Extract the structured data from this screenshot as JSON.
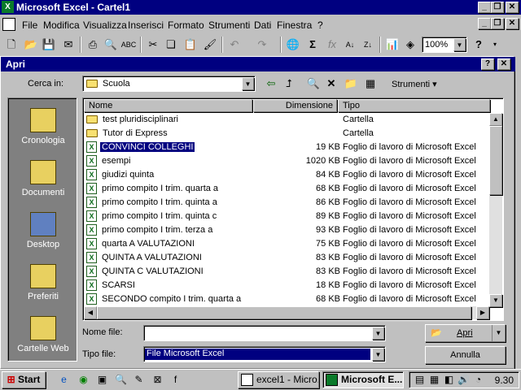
{
  "app": {
    "title": "Microsoft Excel - Cartel1",
    "menu": [
      "File",
      "Modifica",
      "Visualizza",
      "Inserisci",
      "Formato",
      "Strumenti",
      "Dati",
      "Finestra",
      "?"
    ],
    "zoom": "100%",
    "help_glyph": "?"
  },
  "dialog": {
    "title": "Apri",
    "look_in_label": "Cerca in:",
    "look_in_value": "Scuola",
    "tools_label": "Strumenti",
    "places": [
      "Cronologia",
      "Documenti",
      "Desktop",
      "Preferiti",
      "Cartelle Web"
    ],
    "columns": {
      "name": "Nome",
      "size": "Dimensione",
      "type": "Tipo"
    },
    "files": [
      {
        "name": "test pluridisciplinari",
        "size": "",
        "type": "Cartella",
        "kind": "folder"
      },
      {
        "name": "Tutor di Express",
        "size": "",
        "type": "Cartella",
        "kind": "folder"
      },
      {
        "name": "CONVINCI COLLEGHI",
        "size": "19 KB",
        "type": "Foglio di lavoro di Microsoft Excel",
        "kind": "xls",
        "selected": true
      },
      {
        "name": "esempi",
        "size": "1020 KB",
        "type": "Foglio di lavoro di Microsoft Excel",
        "kind": "xls"
      },
      {
        "name": "giudizi quinta",
        "size": "84 KB",
        "type": "Foglio di lavoro di Microsoft Excel",
        "kind": "xls"
      },
      {
        "name": "primo compito I trim. quarta a",
        "size": "68 KB",
        "type": "Foglio di lavoro di Microsoft Excel",
        "kind": "xls"
      },
      {
        "name": "primo compito I trim. quinta a",
        "size": "86 KB",
        "type": "Foglio di lavoro di Microsoft Excel",
        "kind": "xls"
      },
      {
        "name": "primo compito I trim. quinta c",
        "size": "89 KB",
        "type": "Foglio di lavoro di Microsoft Excel",
        "kind": "xls"
      },
      {
        "name": "primo compito I trim. terza a",
        "size": "93 KB",
        "type": "Foglio di lavoro di Microsoft Excel",
        "kind": "xls"
      },
      {
        "name": "quarta A VALUTAZIONI",
        "size": "75 KB",
        "type": "Foglio di lavoro di Microsoft Excel",
        "kind": "xls"
      },
      {
        "name": "QUINTA A VALUTAZIONI",
        "size": "83 KB",
        "type": "Foglio di lavoro di Microsoft Excel",
        "kind": "xls"
      },
      {
        "name": "QUINTA C VALUTAZIONI",
        "size": "83 KB",
        "type": "Foglio di lavoro di Microsoft Excel",
        "kind": "xls"
      },
      {
        "name": "SCARSI",
        "size": "18 KB",
        "type": "Foglio di lavoro di Microsoft Excel",
        "kind": "xls"
      },
      {
        "name": "SECONDO compito I trim. quarta a",
        "size": "68 KB",
        "type": "Foglio di lavoro di Microsoft Excel",
        "kind": "xls"
      }
    ],
    "filename_label": "Nome file:",
    "filename_value": "",
    "filetype_label": "Tipo file:",
    "filetype_value": "File Microsoft Excel",
    "open_button": "Apri",
    "cancel_button": "Annulla"
  },
  "taskbar": {
    "start": "Start",
    "tasks": [
      "excel1 - Micro...",
      "Microsoft E..."
    ],
    "clock": "9.30"
  }
}
